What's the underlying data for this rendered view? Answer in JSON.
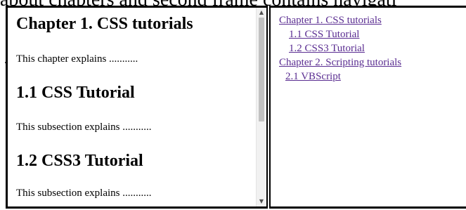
{
  "background": {
    "heading_fragment": "about chapters and second frame contains navigati",
    "stray_mark": "."
  },
  "left_frame": {
    "sections": [
      {
        "heading": "Chapter 1. CSS tutorials",
        "text": "This chapter explains ..........."
      },
      {
        "heading": "1.1 CSS Tutorial",
        "text": "This subsection explains ..........."
      },
      {
        "heading": "1.2 CSS3 Tutorial",
        "text": "This subsection explains ..........."
      }
    ],
    "scroll": {
      "up_arrow": "▲",
      "down_arrow": "▼"
    }
  },
  "right_frame": {
    "links": [
      {
        "label": "Chapter 1. CSS tutorials"
      },
      {
        "label": "1.1 CSS Tutorial"
      },
      {
        "label": "1.2 CSS3 Tutorial"
      },
      {
        "label": "Chapter 2. Scripting tutorials"
      },
      {
        "label": "2.1 VBScript"
      }
    ]
  },
  "colors": {
    "link": "#5a2d91",
    "border": "#000000",
    "scroll_thumb": "#c1c1c1"
  }
}
